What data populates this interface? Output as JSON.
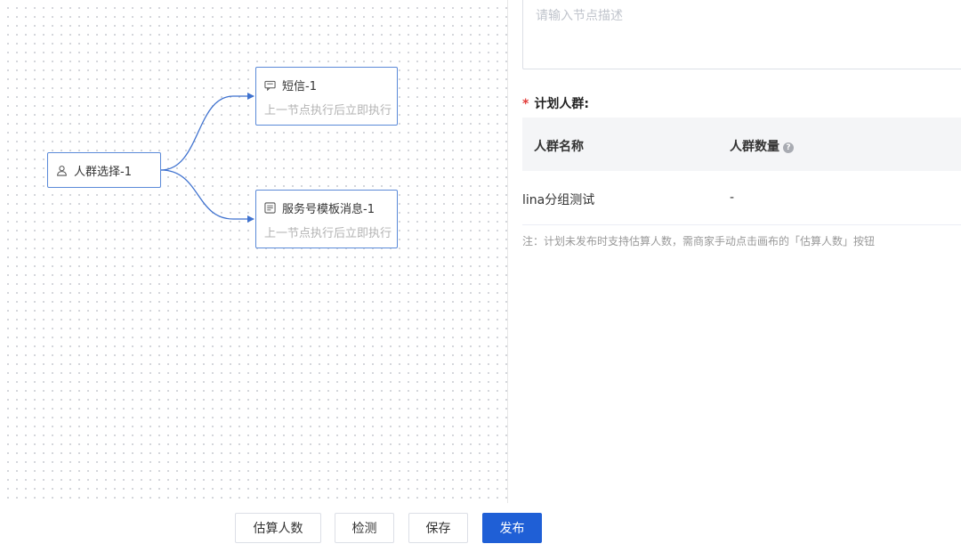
{
  "canvas": {
    "nodes": [
      {
        "id": "crowd",
        "icon": "user-icon",
        "title": "人群选择-1"
      },
      {
        "id": "sms",
        "icon": "message-icon",
        "title": "短信-1",
        "subtitle": "上一节点执行后立即执行"
      },
      {
        "id": "template",
        "icon": "template-icon",
        "title": "服务号模板消息-1",
        "subtitle": "上一节点执行后立即执行"
      }
    ]
  },
  "panel": {
    "description_placeholder": "请输入节点描述",
    "crowd_label": "计划人群:",
    "required_mark": "*",
    "table": {
      "columns": [
        "人群名称",
        "人群数量"
      ],
      "help_icon": "question-icon",
      "rows": [
        {
          "name": "lina分组测试",
          "count": "-"
        }
      ]
    },
    "note": "注：计划未发布时支持估算人数，需商家手动点击画布的「估算人数」按钮"
  },
  "footer": {
    "buttons": [
      "估算人数",
      "检测",
      "保存",
      "发布"
    ]
  },
  "colors": {
    "primary": "#1f5fd6",
    "node_border": "#5b8ad8",
    "required": "#e23c39"
  }
}
